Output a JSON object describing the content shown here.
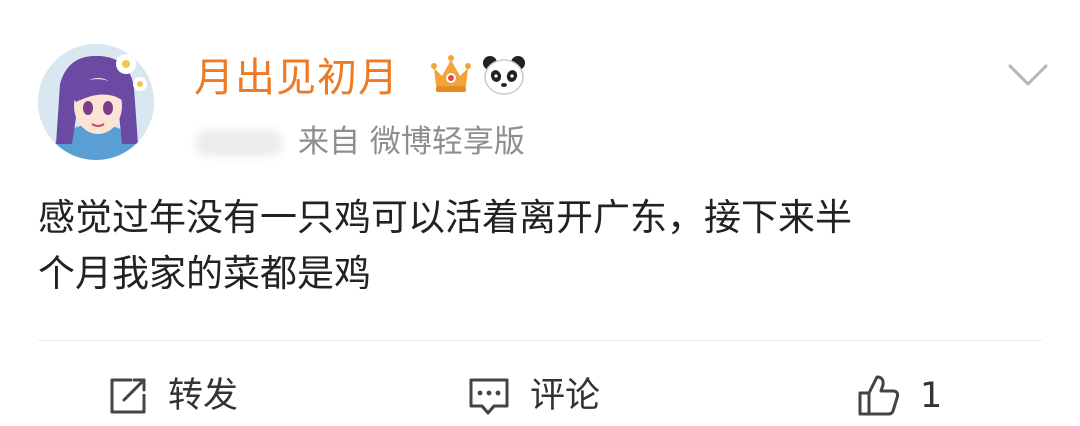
{
  "post": {
    "username": "月出见初月",
    "source": "来自 微博轻享版",
    "content_lines": [
      "感觉过年没有一只鸡可以活着离开广东，接下来半",
      "个月我家的菜都是鸡"
    ]
  },
  "actions": {
    "repost_label": "转发",
    "comment_label": "评论",
    "like_count": "1"
  },
  "icons": {
    "avatar": "anime-girl-avatar",
    "vip_badge": "crown-icon",
    "fan_badge": "panda-icon",
    "more": "chevron-down-icon",
    "repost": "share-icon",
    "comment": "comment-icon",
    "like": "thumbs-up-icon"
  },
  "colors": {
    "username": "#ee7a26",
    "source": "#8e8e8e",
    "content": "#222222",
    "action_text": "#333333"
  }
}
